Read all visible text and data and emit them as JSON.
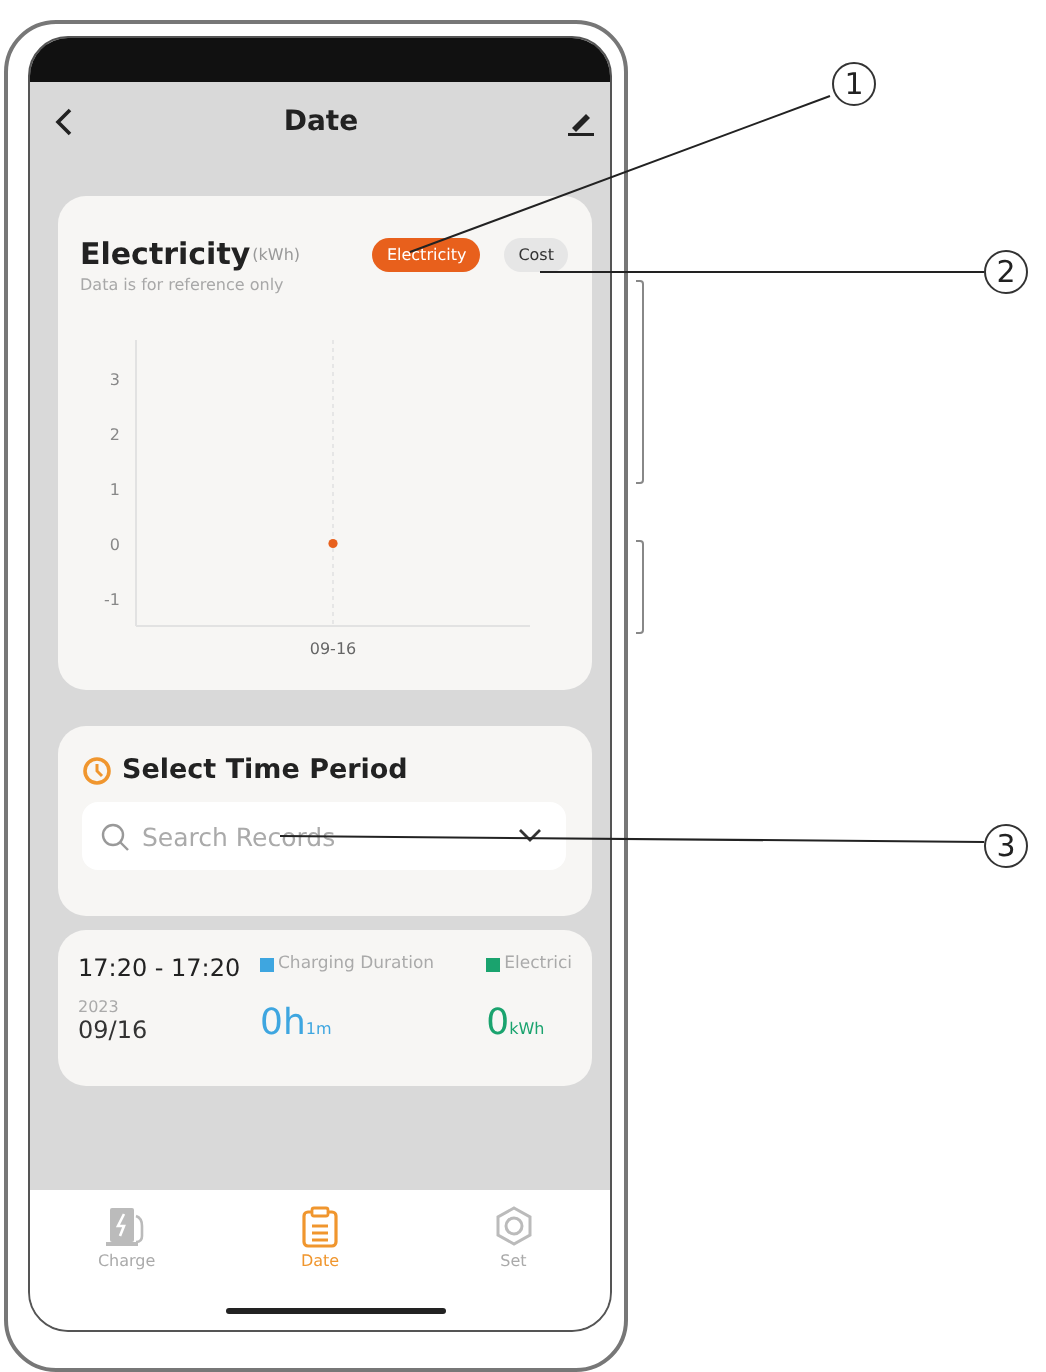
{
  "phone_screen": {
    "header": {
      "title": "Date"
    },
    "chart_card": {
      "title": "Electricity",
      "unit": "(kWh)",
      "note": "Data is for reference only",
      "toggles": [
        {
          "label": "Electricity",
          "selected": true
        },
        {
          "label": "Cost",
          "selected": false
        }
      ],
      "chart_data": {
        "type": "scatter",
        "categories": [
          "09-16"
        ],
        "series": [
          {
            "color": "#e8601c",
            "values": [
              0
            ]
          }
        ],
        "ylim": [
          -1.5,
          3.7
        ],
        "yticks": [
          -1,
          0,
          1,
          2,
          3
        ]
      }
    },
    "time_period_card": {
      "title": "Select Time Period",
      "search": {
        "placeholder": "Search Records"
      }
    },
    "records": [
      {
        "time_range": "17:20 - 17:20",
        "year": "2023",
        "date": "09/16",
        "metrics": [
          {
            "label": "Charging Duration",
            "color": "#3ea6e0",
            "value": "0h",
            "unit": "1m"
          },
          {
            "label": "Electrici",
            "color": "#1aa36e",
            "value": "0",
            "unit": "kWh"
          }
        ]
      }
    ],
    "nav": [
      {
        "label": "Charge",
        "selected": false
      },
      {
        "label": "Date",
        "selected": true
      },
      {
        "label": "Set",
        "selected": false
      }
    ]
  },
  "callouts": [
    "1",
    "2",
    "3"
  ]
}
